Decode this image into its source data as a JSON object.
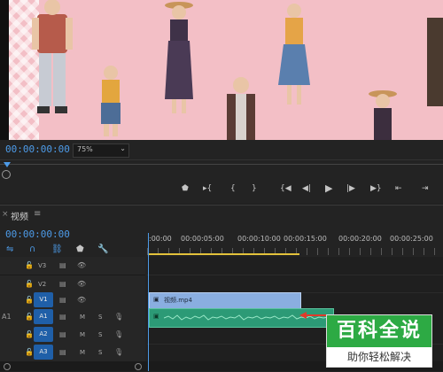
{
  "monitor": {
    "timecode": "00:00:00:00",
    "zoom": "75%"
  },
  "timeline": {
    "panel_title": "视频",
    "timecode": "00:00:00:00",
    "ruler": [
      ":00:00",
      "00:00:05:00",
      "00:00:10:00",
      "00:00:15:00",
      "00:00:20:00",
      "00:00:25:00"
    ],
    "tracks": [
      {
        "id": "V3",
        "toggle": "V3"
      },
      {
        "id": "V2",
        "toggle": "V2"
      },
      {
        "id": "V1",
        "toggle": "V1"
      },
      {
        "id": "A1",
        "toggle": "A1",
        "m": "M",
        "s": "S"
      },
      {
        "id": "A2",
        "toggle": "A2",
        "m": "M",
        "s": "S"
      },
      {
        "id": "A3",
        "toggle": "A3",
        "m": "M",
        "s": "S"
      }
    ],
    "video_clip": "视频.mp4"
  },
  "watermark": {
    "title": "百科全说",
    "subtitle": "助你轻松解决"
  },
  "colors": {
    "accent": "#4d9be8",
    "video_clip": "#8aaee0",
    "audio_clip": "#2c9a76",
    "background": "#f3bfc6"
  }
}
